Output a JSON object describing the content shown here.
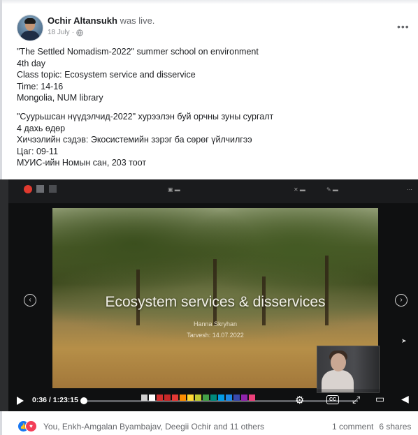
{
  "post": {
    "author": "Ochir Altansukh",
    "action": "was live.",
    "date": "18 July",
    "more": "•••",
    "text_en": [
      "\"The Settled Nomadism-2022\" summer school on environment",
      "4th day",
      "Class topic: Ecosystem service and disservice",
      "Time: 14-16",
      "Mongolia, NUM library"
    ],
    "text_mn": [
      "\"Суурьшсан нүүдэлчид-2022\" хурээлэн буй орчны зуны сургалт",
      "4 дахь өдөр",
      "Хичээлийн сэдэв: Экосистемийн зэрэг ба сөрөг үйлчилгээ",
      "Цаг: 09-11",
      "МУИС-ийн Номын сан, 203 тоот"
    ]
  },
  "slide": {
    "title": "Ecosystem services & disservices",
    "author": "Hanna Skryhan",
    "date": "Tarvesh: 14.07.2022"
  },
  "video": {
    "current_time": "0:36",
    "duration": "1:23:15",
    "progress": 0.0072,
    "nav_prev_icon": "‹",
    "nav_next_icon": "›",
    "palette_colors": [
      "#cfcfcf",
      "#ffffff",
      "#d32f2f",
      "#c62828",
      "#e53935",
      "#fb8c00",
      "#fdd835",
      "#c0ca33",
      "#43a047",
      "#00897b",
      "#039be5",
      "#1e88e5",
      "#3949ab",
      "#8e24aa",
      "#ec407a"
    ]
  },
  "footer": {
    "reactions_text": "You, Enkh-Amgalan Byambajav, Deegii Ochir and 11 others",
    "comments": "1 comment",
    "shares": "6 shares"
  }
}
